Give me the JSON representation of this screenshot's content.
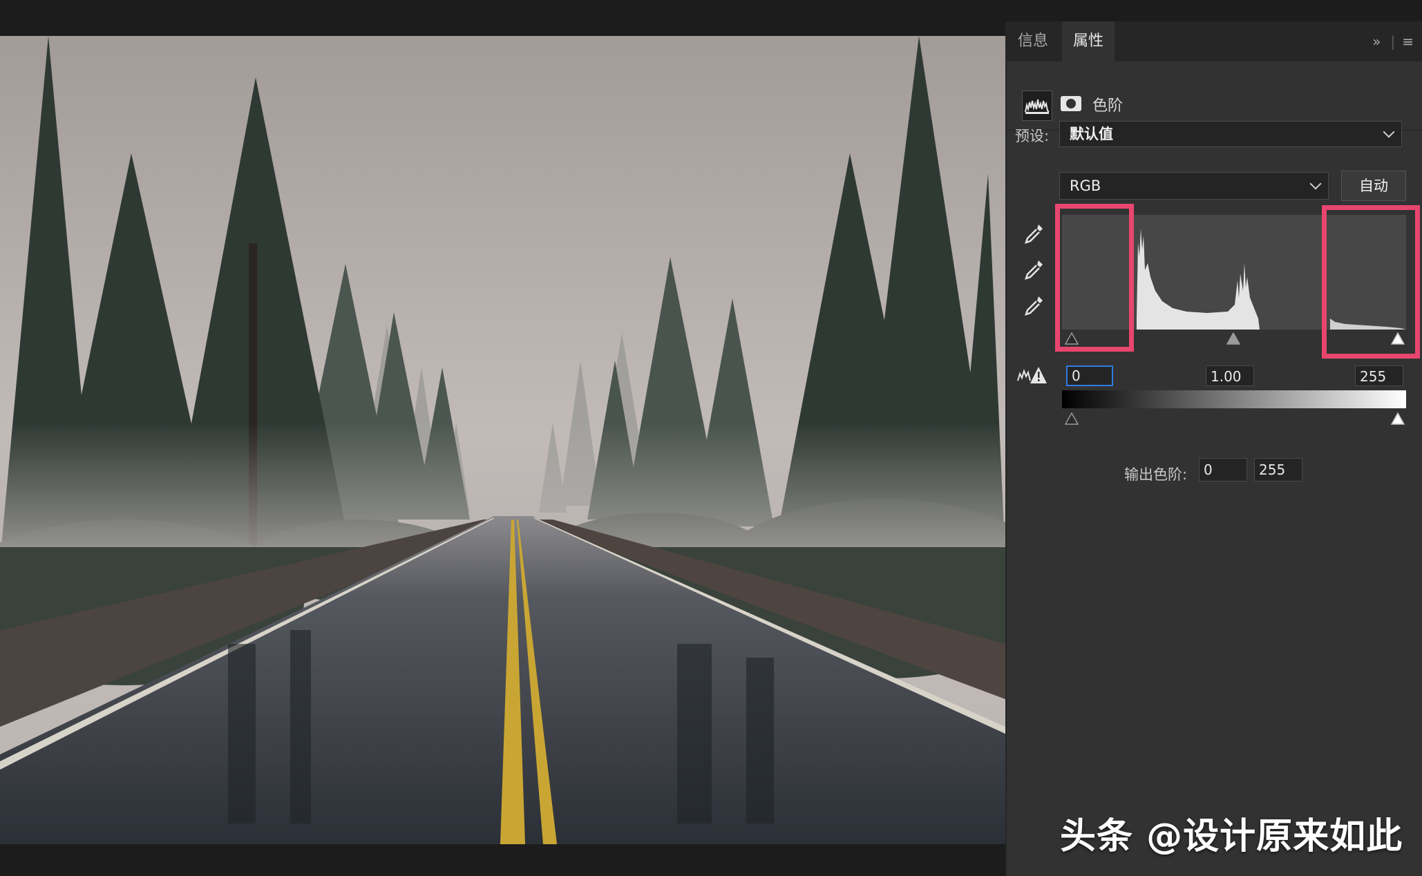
{
  "panel": {
    "tabs": [
      {
        "label": "信息",
        "active": false
      },
      {
        "label": "属性",
        "active": true
      }
    ],
    "tab_tools": {
      "expand": "»",
      "menu": "≡"
    },
    "adjustment_title": "色阶",
    "preset_label": "预设:",
    "preset_value": "默认值",
    "channel_value": "RGB",
    "auto_button": "自动",
    "input_levels": {
      "black": "0",
      "gamma": "1.00",
      "white": "255"
    },
    "output_label": "输出色阶:",
    "output_levels": {
      "black": "0",
      "white": "255"
    },
    "highlight_color": "#e8466f"
  },
  "icons": {
    "histogram": "histogram-icon",
    "mask": "mask-icon",
    "eyedropper_black": "eyedropper-black-icon",
    "eyedropper_gray": "eyedropper-gray-icon",
    "eyedropper_white": "eyedropper-white-icon",
    "clipping": "clipping-warning-icon"
  },
  "watermark": "头条 @设计原来如此"
}
